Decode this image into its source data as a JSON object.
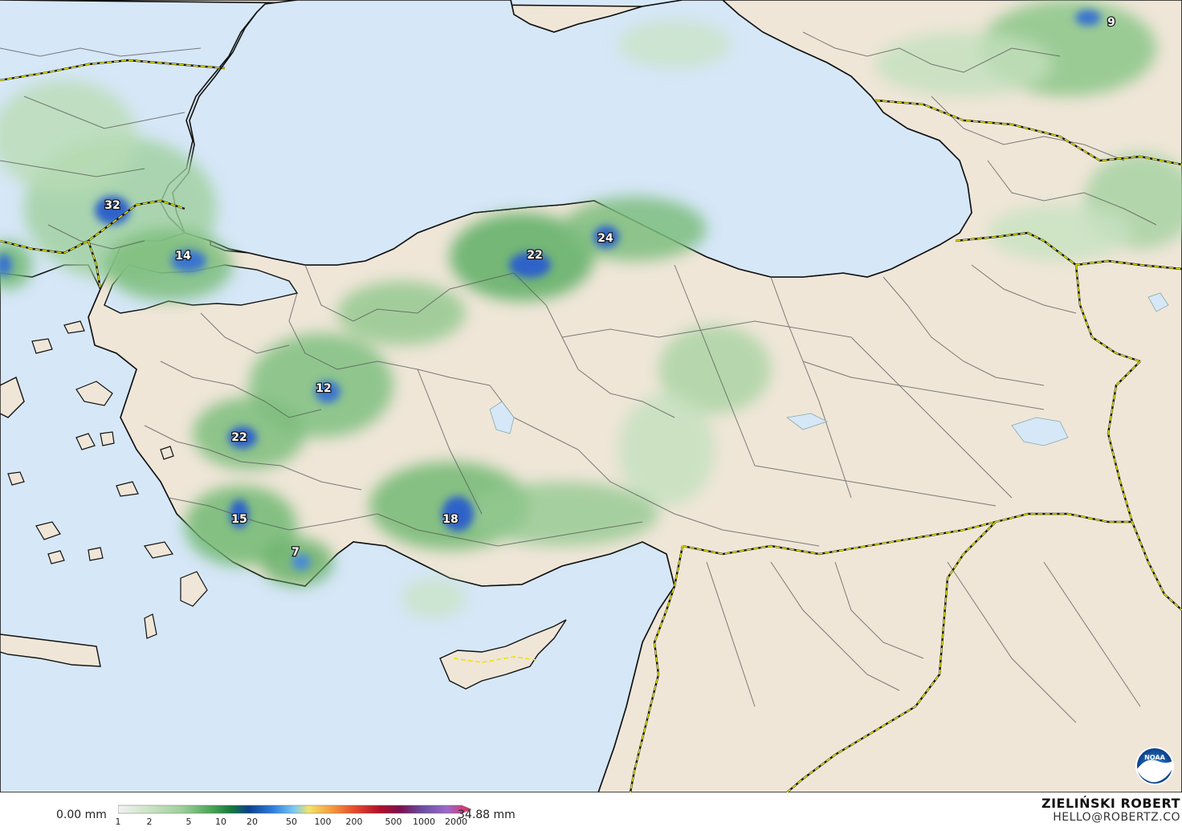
{
  "map": {
    "colors": {
      "sea": "#d6e7f7",
      "land": "#efe6d8",
      "province_border": "#555555",
      "country_border": "#e8e600",
      "coast": "#111111"
    },
    "precip_labels": [
      "32",
      "14",
      "22",
      "24",
      "12",
      "22",
      "18",
      "15",
      "7",
      "9"
    ],
    "logo": "noaa-logo"
  },
  "scale": {
    "min_label": "0.00 mm",
    "max_label": "34.88 mm",
    "ticks": [
      "1",
      "2",
      "5",
      "10",
      "20",
      "50",
      "100",
      "200",
      "500",
      "1000",
      "2000"
    ]
  },
  "credit": {
    "name": "ZIELIŃSKI ROBERT",
    "email": "HELLO@ROBERTZ.CO"
  }
}
